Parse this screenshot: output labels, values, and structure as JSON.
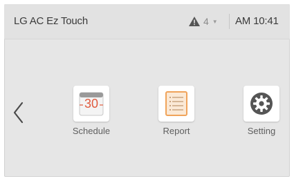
{
  "header": {
    "title": "LG AC Ez Touch",
    "alert_count": "4",
    "time": "AM 10:41"
  },
  "nav": {
    "back_icon": "chevron-left-icon"
  },
  "tiles": [
    {
      "label": "Schedule",
      "icon": "calendar-icon",
      "day": "30",
      "accent": "#e05a3e"
    },
    {
      "label": "Report",
      "icon": "report-icon",
      "accent": "#f0a35a"
    },
    {
      "label": "Setting",
      "icon": "gear-icon",
      "accent": "#555555"
    }
  ],
  "colors": {
    "background": "#e6e6e6",
    "text": "#3a3a3a",
    "label": "#5e5e5e"
  }
}
